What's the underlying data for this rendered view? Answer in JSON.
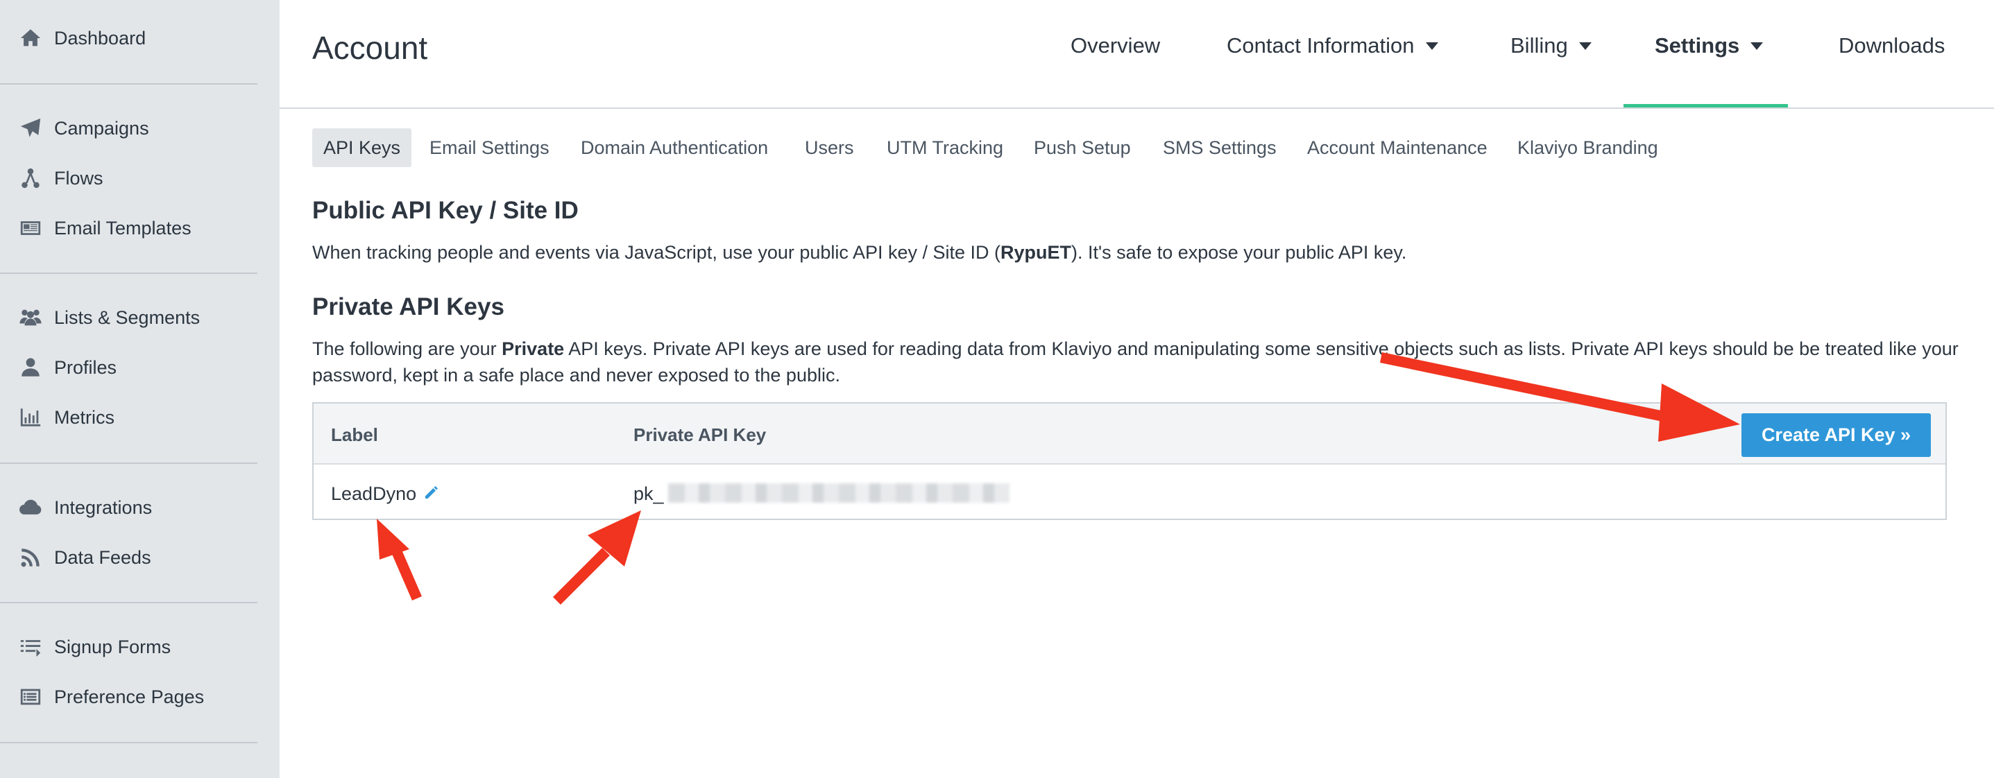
{
  "sidebar": {
    "items": [
      {
        "label": "Dashboard",
        "icon": "home-icon"
      },
      {
        "label": "Campaigns",
        "icon": "paper-plane-icon"
      },
      {
        "label": "Flows",
        "icon": "flow-icon"
      },
      {
        "label": "Email Templates",
        "icon": "newspaper-icon"
      },
      {
        "label": "Lists & Segments",
        "icon": "users-icon"
      },
      {
        "label": "Profiles",
        "icon": "user-icon"
      },
      {
        "label": "Metrics",
        "icon": "bar-chart-icon"
      },
      {
        "label": "Integrations",
        "icon": "cloud-icon"
      },
      {
        "label": "Data Feeds",
        "icon": "rss-icon"
      },
      {
        "label": "Signup Forms",
        "icon": "list-icon"
      },
      {
        "label": "Preference Pages",
        "icon": "list-alt-icon"
      }
    ]
  },
  "header": {
    "title": "Account",
    "tabs": [
      {
        "label": "Overview",
        "dropdown": false
      },
      {
        "label": "Contact Information",
        "dropdown": true
      },
      {
        "label": "Billing",
        "dropdown": true
      },
      {
        "label": "Settings",
        "dropdown": true,
        "active": true
      },
      {
        "label": "Downloads",
        "dropdown": false
      }
    ]
  },
  "subtabs": [
    "API Keys",
    "Email Settings",
    "Domain Authentication",
    "Users",
    "UTM Tracking",
    "Push Setup",
    "SMS Settings",
    "Account Maintenance",
    "Klaviyo Branding"
  ],
  "public_section": {
    "heading": "Public API Key / Site ID",
    "text_before": "When tracking people and events via JavaScript, use your public API key / Site ID (",
    "site_id": "RypuET",
    "text_after": "). It's safe to expose your public API key."
  },
  "private_section": {
    "heading": "Private API Keys",
    "text_before": "The following are your ",
    "bold_word": "Private",
    "text_after": " API keys. Private API keys are used for reading data from Klaviyo and manipulating some sensitive objects such as lists. Private API keys should be be treated like your password, kept in a safe place and never exposed to the public."
  },
  "table": {
    "col_label": "Label",
    "col_key": "Private API Key",
    "create_button": "Create API Key »",
    "rows": [
      {
        "label": "LeadDyno",
        "key_prefix": "pk_"
      }
    ]
  },
  "colors": {
    "accent_green": "#35c48f",
    "button_blue": "#2f97d9",
    "annotation_red": "#f0341f",
    "pencil_blue": "#2f97d9"
  }
}
